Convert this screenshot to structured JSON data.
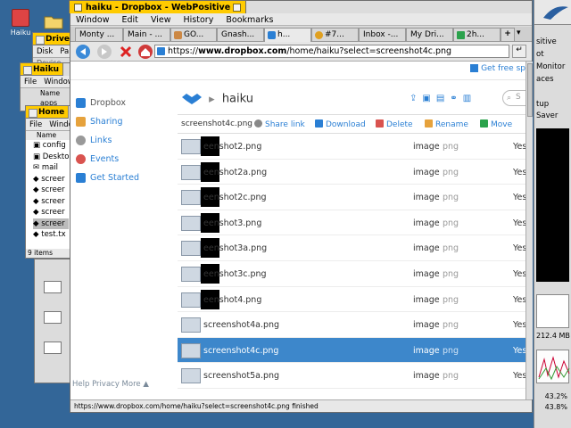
{
  "desktop": {
    "home_label": "Haiku"
  },
  "bg_windows": [
    {
      "title": "Drive",
      "menu": [
        "Disk",
        "Pa"
      ],
      "sub": "Device"
    },
    {
      "title": "Haiku",
      "menu": [
        "File",
        "Window"
      ],
      "header": "Name",
      "items": [
        "apps"
      ]
    },
    {
      "title": "Home",
      "menu": [
        "File",
        "Windo"
      ],
      "header": "Name",
      "items": [
        "config",
        "Deskto",
        "mail",
        "screer",
        "screer",
        "screer",
        "screer",
        "screer",
        "test.tx"
      ],
      "count": "9 items"
    }
  ],
  "deskbar": {
    "items": [
      "sitive",
      "ot",
      "Monitor",
      "aces",
      "Saver",
      "tup"
    ],
    "memory": "212.4 MB",
    "cpu1": "43.2%",
    "cpu2": "43.8%"
  },
  "window": {
    "title": "haiku - Dropbox - WebPositive",
    "menu": [
      "Window",
      "Edit",
      "View",
      "History",
      "Bookmarks"
    ],
    "tabs": [
      "Monty ...",
      "Main - ...",
      "GO...",
      "Gnash...",
      "h...",
      "#7...",
      "Inbox -...",
      "My Dri...",
      "2h...",
      "+"
    ],
    "url_prefix": "https://",
    "url_domain": "www.dropbox.com",
    "url_path": "/home/haiku?select=screenshot4c.png",
    "status": "https://www.dropbox.com/home/haiku?select=screenshot4c.png finished",
    "go_label": "↵"
  },
  "page": {
    "get_free": "Get free sp",
    "nav": [
      {
        "label": "Dropbox",
        "icon": "dropbox-icon",
        "color": "#2a7fd4"
      },
      {
        "label": "Sharing",
        "icon": "sharing-icon",
        "color": "#e6a23c"
      },
      {
        "label": "Links",
        "icon": "links-icon",
        "color": "#999999"
      },
      {
        "label": "Events",
        "icon": "events-icon",
        "color": "#d9534f"
      },
      {
        "label": "Get Started",
        "icon": "get-started-icon",
        "color": "#2a7fd4"
      }
    ],
    "help": "Help  Privacy  More  ▲",
    "folder_title": "haiku",
    "search_placeholder": "S",
    "action_file": "screenshot4c.png",
    "actions": [
      "Share link",
      "Download",
      "Delete",
      "Rename",
      "Move"
    ],
    "files": [
      {
        "name": "eenshot2.png",
        "kind": "image",
        "ext": "png",
        "shared": "Yes",
        "redacted": true
      },
      {
        "name": "eenshot2a.png",
        "kind": "image",
        "ext": "png",
        "shared": "Yes",
        "redacted": true
      },
      {
        "name": "eenshot2c.png",
        "kind": "image",
        "ext": "png",
        "shared": "Yes",
        "redacted": true
      },
      {
        "name": "eenshot3.png",
        "kind": "image",
        "ext": "png",
        "shared": "Yes",
        "redacted": true
      },
      {
        "name": "eenshot3a.png",
        "kind": "image",
        "ext": "png",
        "shared": "Yes",
        "redacted": true
      },
      {
        "name": "eenshot3c.png",
        "kind": "image",
        "ext": "png",
        "shared": "Yes",
        "redacted": true
      },
      {
        "name": "eenshot4.png",
        "kind": "image",
        "ext": "png",
        "shared": "Yes",
        "redacted": true
      },
      {
        "name": "screenshot4a.png",
        "kind": "image",
        "ext": "png",
        "shared": "Yes",
        "redacted": false
      },
      {
        "name": "screenshot4c.png",
        "kind": "image",
        "ext": "png",
        "shared": "Yes",
        "redacted": false,
        "selected": true
      },
      {
        "name": "screenshot5a.png",
        "kind": "image",
        "ext": "png",
        "shared": "Yes",
        "redacted": false
      }
    ]
  }
}
